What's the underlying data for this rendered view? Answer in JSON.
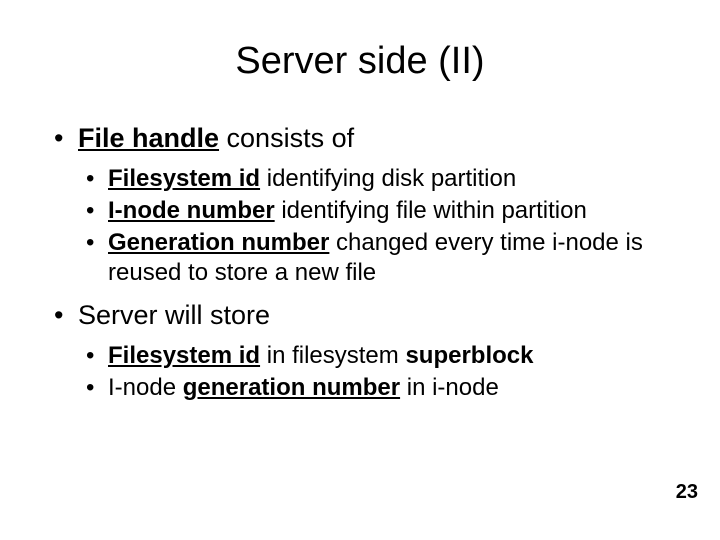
{
  "title": "Server side (II)",
  "bullets": [
    {
      "lead_bu": "File handle",
      "rest": " consists of",
      "sub": [
        {
          "term_bu": "Filesystem id",
          "rest": " identifying disk partition"
        },
        {
          "term_bu": "I-node number",
          "rest": " identifying file within partition"
        },
        {
          "term_bu": "Generation number",
          "rest": " changed every time i-node is reused to store a new file"
        }
      ]
    },
    {
      "plain": "Server will store",
      "sub2": [
        {
          "term_bu": "Filesystem id",
          "mid": " in filesystem ",
          "tail_b": "superblock"
        },
        {
          "pre": "I-node ",
          "term_bu": "generation number",
          "mid": " in i-node"
        }
      ]
    }
  ],
  "page_number": "23"
}
